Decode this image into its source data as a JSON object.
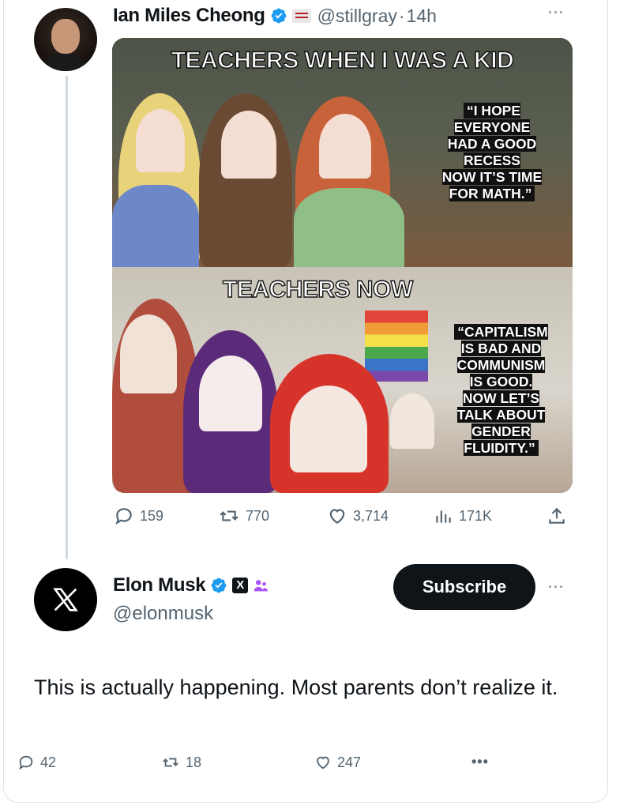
{
  "tweet": {
    "author_name": "Ian Miles Cheong",
    "author_handle": "@stillgray",
    "separator": "·",
    "time": "14h",
    "media": {
      "top_caption": "TEACHERS WHEN I WAS A KID",
      "top_quote": "“I HOPE\nEVERYONE\nHAD A GOOD\nRECESS\nNOW IT’S TIME\nFOR MATH.”",
      "bottom_caption": "TEACHERS NOW",
      "bottom_quote": "“CAPITALISM\nIS BAD AND\nCOMMUNISM\nIS GOOD.\nNOW LET’S\nTALK ABOUT\nGENDER\nFLUIDITY.”"
    },
    "stats": {
      "replies": "159",
      "retweets": "770",
      "likes": "3,714",
      "views": "171K"
    }
  },
  "reply": {
    "author_name": "Elon Musk",
    "author_handle": "@elonmusk",
    "subscribe_label": "Subscribe",
    "text": "This is actually happening. Most parents don’t realize it.",
    "stats": {
      "replies": "42",
      "retweets": "18",
      "likes": "247"
    }
  },
  "colors": {
    "verified": "#1d9bf0",
    "text": "#0f1419",
    "muted": "#536471",
    "affiliate": "#a855f7"
  }
}
